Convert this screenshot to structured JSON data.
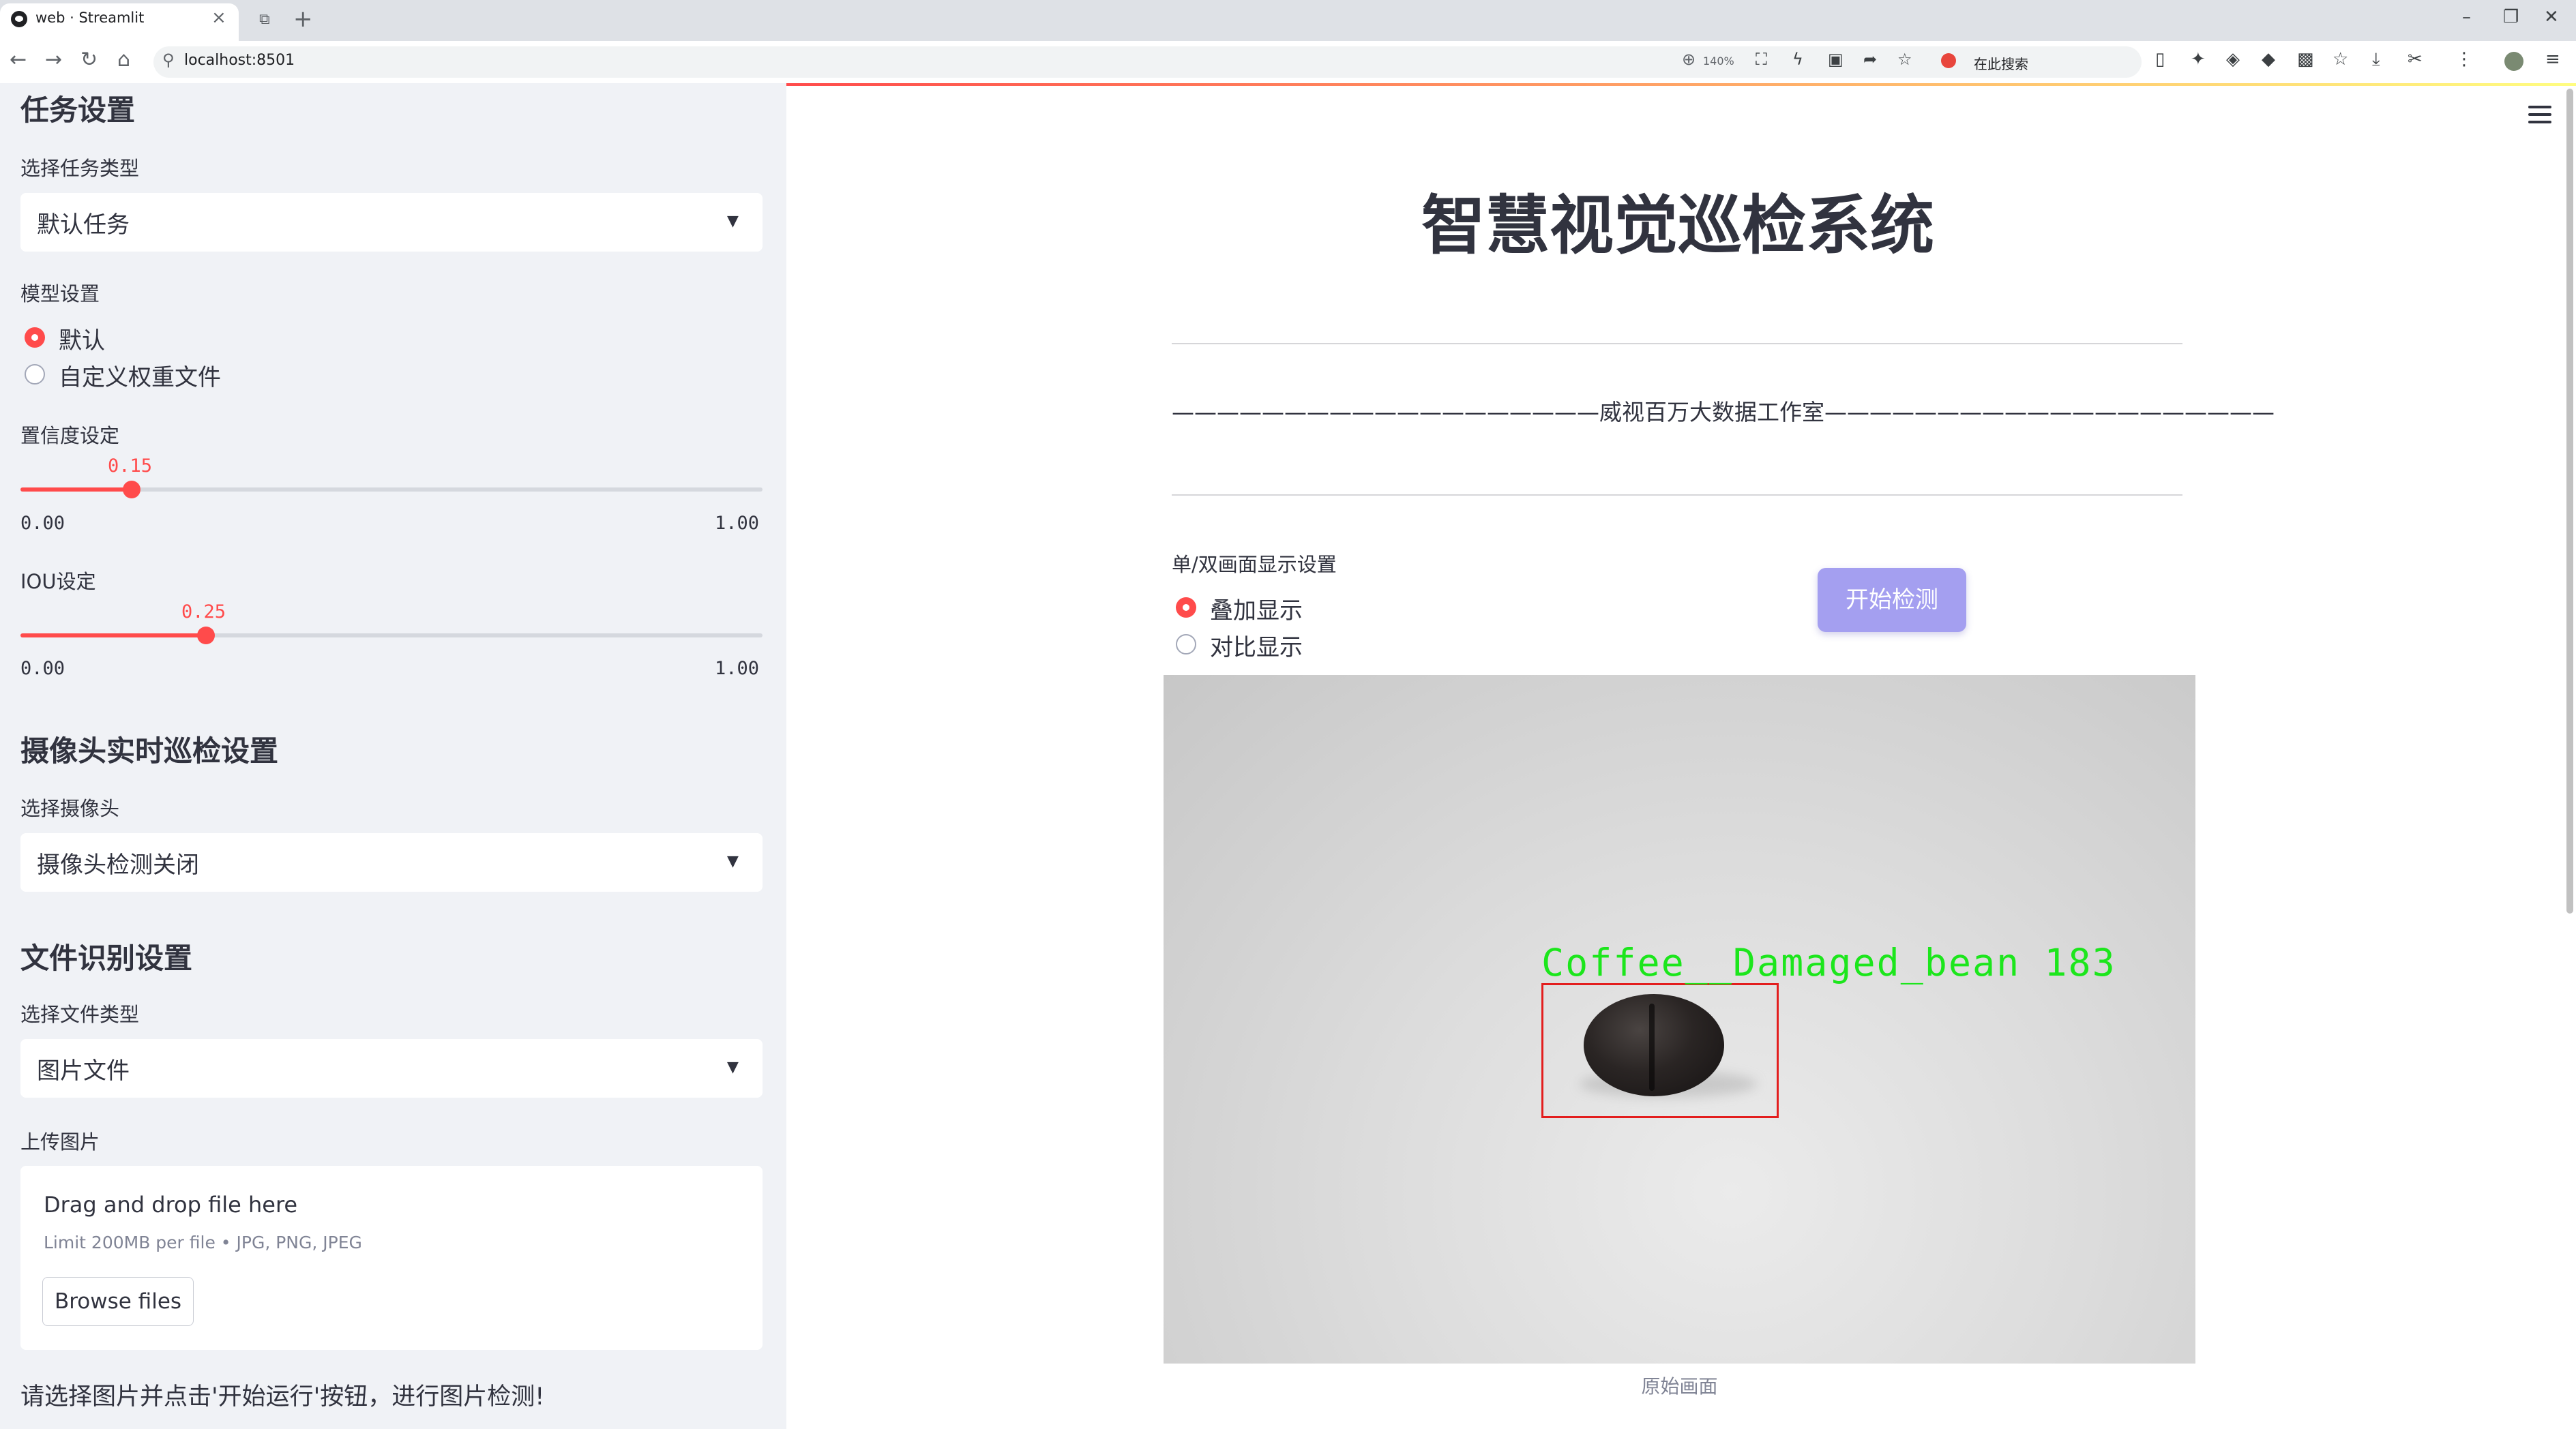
{
  "browser": {
    "tab_title": "web · Streamlit",
    "url": "localhost:8501",
    "zoom": "140%",
    "search_placeholder": "在此搜索",
    "icons": [
      "back-icon",
      "forward-icon",
      "reload-icon",
      "home-icon",
      "zoom-icon",
      "translate-icon",
      "bolt-icon",
      "screenshot-icon",
      "share-icon",
      "star-icon",
      "bookmark-icon",
      "extension-icon",
      "download-icon",
      "scissors-icon",
      "menu-icon"
    ]
  },
  "sidebar": {
    "task_section_title": "任务设置",
    "task_type_label": "选择任务类型",
    "task_type_value": "默认任务",
    "model_label": "模型设置",
    "model_options": [
      "默认",
      "自定义权重文件"
    ],
    "model_selected": "默认",
    "confidence_label": "置信度设定",
    "confidence_value": "0.15",
    "confidence_min": "0.00",
    "confidence_max": "1.00",
    "iou_label": "IOU设定",
    "iou_value": "0.25",
    "iou_min": "0.00",
    "iou_max": "1.00",
    "camera_section_title": "摄像头实时巡检设置",
    "camera_label": "选择摄像头",
    "camera_value": "摄像头检测关闭",
    "file_section_title": "文件识别设置",
    "file_type_label": "选择文件类型",
    "file_type_value": "图片文件",
    "upload_label": "上传图片",
    "upload_drop_text": "Drag and drop file here",
    "upload_limit_text": "Limit 200MB per file • JPG, PNG, JPEG",
    "browse_button": "Browse files",
    "note": "请选择图片并点击'开始运行'按钮，进行图片检测!"
  },
  "main": {
    "title": "智慧视觉巡检系统",
    "studio_line": "———————————————————威视百万大数据工作室————————————————————",
    "display_label": "单/双画面显示设置",
    "display_options": [
      "叠加显示",
      "对比显示"
    ],
    "display_selected": "叠加显示",
    "start_button": "开始检测",
    "image_caption": "原始画面",
    "detection_label": "Coffee__Damaged_bean  183"
  },
  "colors": {
    "accent": "#ff4b4b",
    "sidebar_bg": "#f0f2f6",
    "start_button": "#a49ff0",
    "detection_box": "#e31e1e",
    "detection_text": "#1ce61c"
  }
}
